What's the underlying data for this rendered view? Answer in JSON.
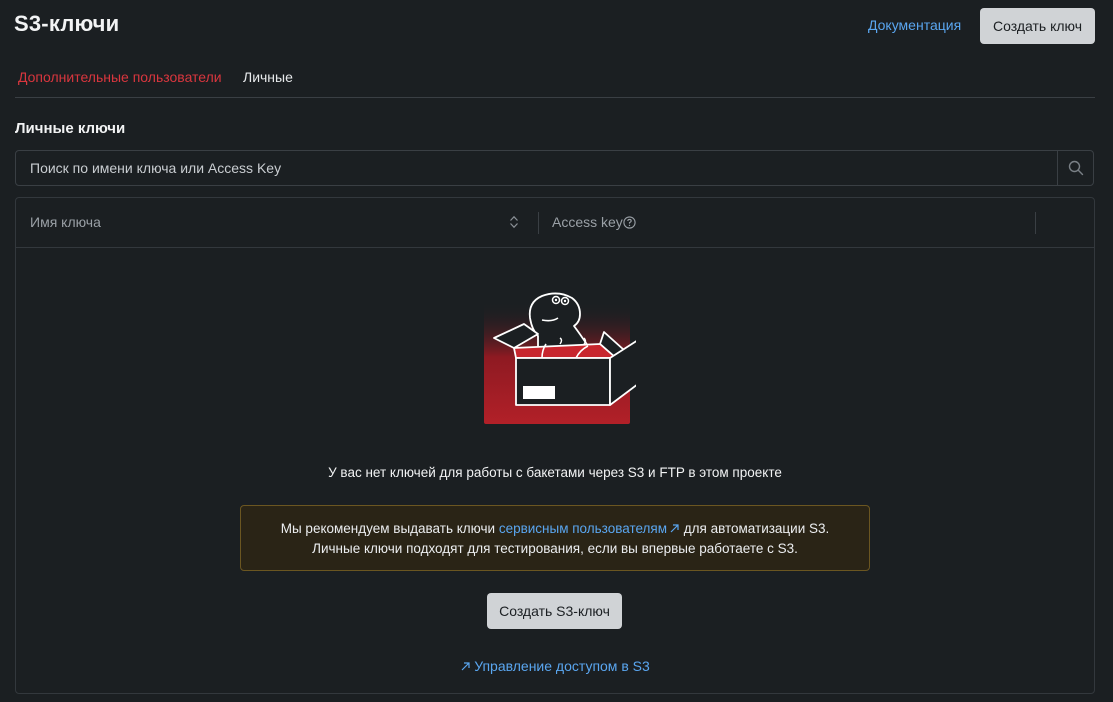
{
  "header": {
    "title": "S3-ключи",
    "doc_link": "Документация",
    "create_button": "Создать ключ"
  },
  "tabs": [
    {
      "label": "Дополнительные пользователи",
      "active": true
    },
    {
      "label": "Личные",
      "active": false
    }
  ],
  "section_title": "Личные ключи",
  "search": {
    "placeholder": "Поиск по имени ключа или Access Key",
    "value": ""
  },
  "table": {
    "columns": [
      "Имя ключа",
      "Access key"
    ]
  },
  "empty_state": {
    "message": "У вас нет ключей для работы с бакетами через S3 и FTP в этом проекте",
    "notice_prefix": "Мы рекомендуем выдавать ключи ",
    "notice_link": "сервисным пользователям",
    "notice_suffix": " для автоматизации S3. Личные ключи подходят для тестирования, если вы впервые работаете с S3.",
    "create_button": "Создать S3-ключ",
    "access_link": "Управление доступом в S3"
  },
  "colors": {
    "background": "#1b1f22",
    "accent_red": "#d9363e",
    "link_blue": "#5aa6f0",
    "notice_bg": "#2a2416",
    "notice_border": "#6b5621"
  },
  "icons": [
    "search-icon",
    "sort-icon",
    "help-circle-icon",
    "external-link-icon"
  ]
}
